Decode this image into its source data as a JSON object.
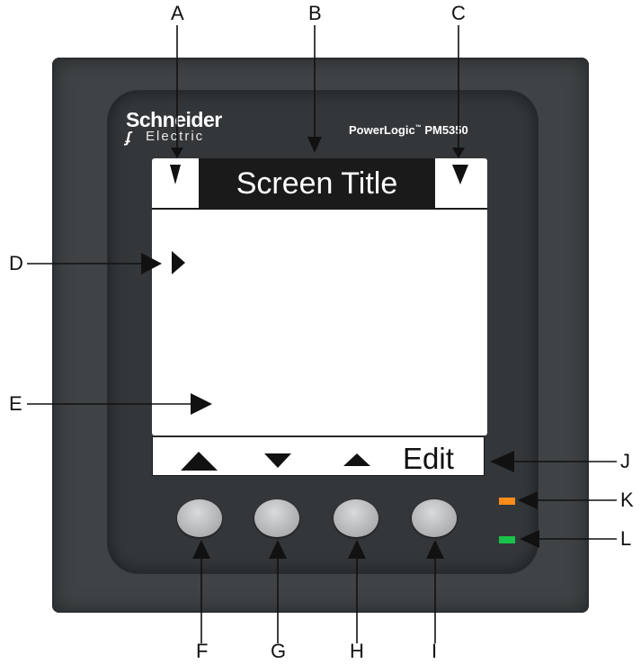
{
  "device": {
    "brand_name": "Schneider",
    "brand_sub": "Electric",
    "model_prefix": "PowerLogic",
    "model_tm": "™",
    "model_number": "PM5350",
    "screen_title": "Screen Title",
    "softkey_edit_label": "Edit",
    "led_colors": {
      "orange": "#ff8c1a",
      "green": "#19c24a"
    },
    "panel_color": "#3f4345"
  },
  "callouts": {
    "A": "A",
    "B": "B",
    "C": "C",
    "D": "D",
    "E": "E",
    "F": "F",
    "G": "G",
    "H": "H",
    "I": "I",
    "J": "J",
    "K": "K",
    "L": "L"
  }
}
